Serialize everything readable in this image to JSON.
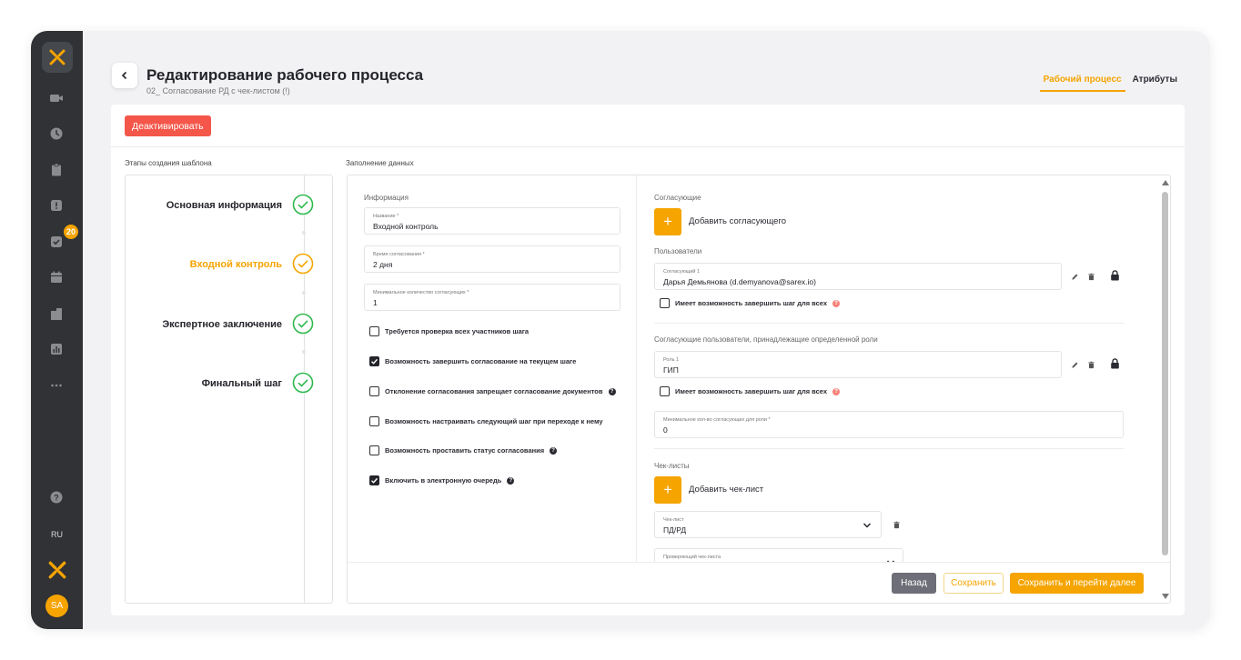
{
  "sidebar": {
    "badge_count": "20",
    "language": "RU",
    "avatar_initials": "SA",
    "icons": [
      "video-icon",
      "clock-icon",
      "clipboard-icon",
      "alert-icon",
      "check-task-icon",
      "calendar-icon",
      "building-icon",
      "chart-icon",
      "more-icon",
      "help-icon"
    ]
  },
  "header": {
    "title": "Редактирование рабочего процесса",
    "subtitle": "02_ Согласование РД с чек-листом (!)",
    "tabs": [
      {
        "label": "Рабочий процесс",
        "active": true
      },
      {
        "label": "Атрибуты",
        "active": false
      }
    ]
  },
  "actions": {
    "deactivate_label": "Деактивировать"
  },
  "steps_section": {
    "label": "Этапы создания шаблона",
    "steps": [
      {
        "label": "Основная информация",
        "state": "done"
      },
      {
        "label": "Входной контроль",
        "state": "current"
      },
      {
        "label": "Экспертное заключение",
        "state": "done"
      },
      {
        "label": "Финальный шаг",
        "state": "done"
      }
    ]
  },
  "form_section": {
    "label": "Заполнение данных",
    "info": {
      "heading": "Информация",
      "fields": [
        {
          "label": "Название *",
          "value": "Входной контроль"
        },
        {
          "label": "Время согласования *",
          "value": "2 дня"
        },
        {
          "label": "Минимальное количество согласующих *",
          "value": "1"
        }
      ],
      "checkboxes": [
        {
          "label": "Требуется проверка всех участников шага",
          "checked": false,
          "help": false
        },
        {
          "label": "Возможность завершить согласование на текущем шаге",
          "checked": true,
          "help": false
        },
        {
          "label": "Отклонение согласования запрещает согласование документов",
          "checked": false,
          "help": true
        },
        {
          "label": "Возможность настраивать следующий шаг при переходе к нему",
          "checked": false,
          "help": false
        },
        {
          "label": "Возможность проставить статус согласования",
          "checked": false,
          "help": true
        },
        {
          "label": "Включить в электронную очередь",
          "checked": true,
          "help": true
        }
      ],
      "help_glyph": "?"
    },
    "approvers": {
      "heading": "Согласующие",
      "add_glyph": "+",
      "add_label": "Добавить согласующего",
      "users_heading": "Пользователи",
      "user_field": {
        "label": "Согласующий 1",
        "value": "Дарья Демьянова (d.demyanova@sarex.io)"
      },
      "user_can_finish": "Имеет возможность завершить шаг для всех",
      "roles_heading": "Согласующие пользователи, принадлежащие определенной роли",
      "role_field": {
        "label": "Роль 1",
        "value": "ГИП"
      },
      "role_can_finish": "Имеет возможность завершить шаг для всех",
      "min_role_field": {
        "label": "Минимальное кол-во согласующих для роли *",
        "value": "0"
      }
    },
    "checklists": {
      "heading": "Чек-листы",
      "add_glyph": "+",
      "add_label": "Добавить чек-лист",
      "checklist_field": {
        "label": "Чек-лист",
        "value": "ПД/РД"
      },
      "reviewer_field": {
        "label": "Проверяющий чек-листа",
        "value": ""
      }
    }
  },
  "footer": {
    "back_label": "Назад",
    "save_label": "Сохранить",
    "save_next_label": "Сохранить и перейти далее"
  },
  "colors": {
    "accent": "#f5a400",
    "danger": "#f4574a",
    "success": "#2db84c",
    "sidebar": "#303236"
  }
}
